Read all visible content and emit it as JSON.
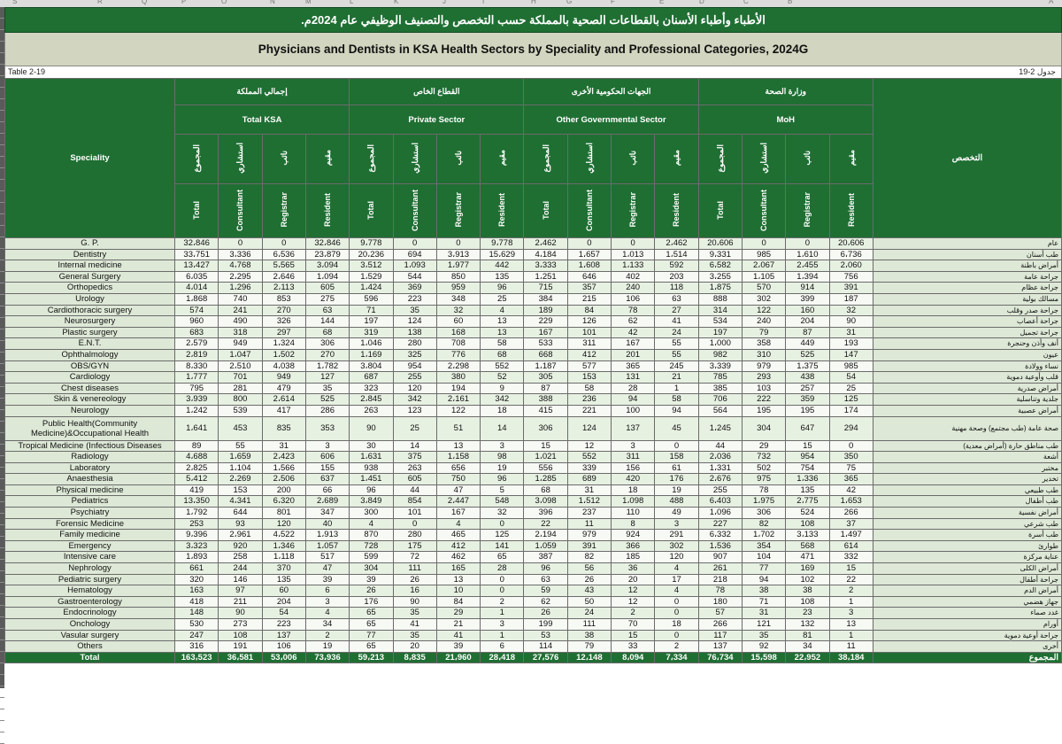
{
  "sheet_columns": [
    "S",
    "R",
    "Q",
    "P",
    "O",
    "N",
    "M",
    "L",
    "K",
    "J",
    "I",
    "H",
    "G",
    "F",
    "E",
    "D",
    "C",
    "B",
    "A"
  ],
  "title_ar": "الأطباء وأطباء الأسنان بالقطاعات الصحية بالمملكة حسب التخصص والتصنيف الوظيفي عام 2024م.",
  "title_en": "Physicians and Dentists in KSA Health Sectors by Speciality and Professional Categories, 2024G",
  "table_label_en": "Table 2-19",
  "table_label_ar": "جدول 2-19",
  "speciality_header_en": "Speciality",
  "speciality_header_ar": "التخصص",
  "groups": [
    {
      "ar": "إجمالي المملكة",
      "en": "Total KSA"
    },
    {
      "ar": "القطاع الخاص",
      "en": "Private Sector"
    },
    {
      "ar": "الجهات الحكومية الأخرى",
      "en": "Other Governmental Sector"
    },
    {
      "ar": "وزارة الصحة",
      "en": "MoH"
    }
  ],
  "subcols_ar": [
    "المجموع",
    "استشاري",
    "نائب",
    "مقيم"
  ],
  "subcols_en": [
    "Total",
    "Consultant",
    "Registrar",
    "Resident"
  ],
  "rows": [
    {
      "en": "G. P.",
      "ar": "عام",
      "v": [
        "32،846",
        "0",
        "0",
        "32،846",
        "9،778",
        "0",
        "0",
        "9،778",
        "2،462",
        "0",
        "0",
        "2،462",
        "20،606",
        "0",
        "0",
        "20،606"
      ]
    },
    {
      "en": "Dentistry",
      "ar": "طب أسنان",
      "v": [
        "33،751",
        "3،336",
        "6،536",
        "23،879",
        "20،236",
        "694",
        "3،913",
        "15،629",
        "4،184",
        "1،657",
        "1،013",
        "1،514",
        "9،331",
        "985",
        "1،610",
        "6،736"
      ]
    },
    {
      "en": "Internal medicine",
      "ar": "أمراض باطنة",
      "v": [
        "13،427",
        "4،768",
        "5،565",
        "3،094",
        "3،512",
        "1،093",
        "1،977",
        "442",
        "3،333",
        "1،608",
        "1،133",
        "592",
        "6،582",
        "2،067",
        "2،455",
        "2،060"
      ]
    },
    {
      "en": "General Surgery",
      "ar": "جراحة عامة",
      "v": [
        "6،035",
        "2،295",
        "2،646",
        "1،094",
        "1،529",
        "544",
        "850",
        "135",
        "1،251",
        "646",
        "402",
        "203",
        "3،255",
        "1،105",
        "1،394",
        "756"
      ]
    },
    {
      "en": "Orthopedics",
      "ar": "جراحة عظام",
      "v": [
        "4،014",
        "1،296",
        "2،113",
        "605",
        "1،424",
        "369",
        "959",
        "96",
        "715",
        "357",
        "240",
        "118",
        "1،875",
        "570",
        "914",
        "391"
      ]
    },
    {
      "en": "Urology",
      "ar": "مسالك بولية",
      "v": [
        "1،868",
        "740",
        "853",
        "275",
        "596",
        "223",
        "348",
        "25",
        "384",
        "215",
        "106",
        "63",
        "888",
        "302",
        "399",
        "187"
      ]
    },
    {
      "en": "Cardiothoracic surgery",
      "ar": "جراحة صدر وقلب",
      "v": [
        "574",
        "241",
        "270",
        "63",
        "71",
        "35",
        "32",
        "4",
        "189",
        "84",
        "78",
        "27",
        "314",
        "122",
        "160",
        "32"
      ]
    },
    {
      "en": "Neurosurgery",
      "ar": "جراحة أعصاب",
      "v": [
        "960",
        "490",
        "326",
        "144",
        "197",
        "124",
        "60",
        "13",
        "229",
        "126",
        "62",
        "41",
        "534",
        "240",
        "204",
        "90"
      ]
    },
    {
      "en": "Plastic surgery",
      "ar": "جراحة تجميل",
      "v": [
        "683",
        "318",
        "297",
        "68",
        "319",
        "138",
        "168",
        "13",
        "167",
        "101",
        "42",
        "24",
        "197",
        "79",
        "87",
        "31"
      ]
    },
    {
      "en": "E.N.T.",
      "ar": "أنف وأذن وحنجرة",
      "v": [
        "2،579",
        "949",
        "1،324",
        "306",
        "1،046",
        "280",
        "708",
        "58",
        "533",
        "311",
        "167",
        "55",
        "1،000",
        "358",
        "449",
        "193"
      ]
    },
    {
      "en": "Ophthalmology",
      "ar": "عيون",
      "v": [
        "2،819",
        "1،047",
        "1،502",
        "270",
        "1،169",
        "325",
        "776",
        "68",
        "668",
        "412",
        "201",
        "55",
        "982",
        "310",
        "525",
        "147"
      ]
    },
    {
      "en": "OBS/GYN",
      "ar": "نساء وولادة",
      "v": [
        "8،330",
        "2،510",
        "4،038",
        "1،782",
        "3،804",
        "954",
        "2،298",
        "552",
        "1،187",
        "577",
        "365",
        "245",
        "3،339",
        "979",
        "1،375",
        "985"
      ]
    },
    {
      "en": "Cardiology",
      "ar": "قلب وأوعية دموية",
      "v": [
        "1،777",
        "701",
        "949",
        "127",
        "687",
        "255",
        "380",
        "52",
        "305",
        "153",
        "131",
        "21",
        "785",
        "293",
        "438",
        "54"
      ]
    },
    {
      "en": "Chest diseases",
      "ar": "أمراض صدرية",
      "v": [
        "795",
        "281",
        "479",
        "35",
        "323",
        "120",
        "194",
        "9",
        "87",
        "58",
        "28",
        "1",
        "385",
        "103",
        "257",
        "25"
      ]
    },
    {
      "en": "Skin & venereology",
      "ar": "جلدية وتناسلية",
      "v": [
        "3،939",
        "800",
        "2،614",
        "525",
        "2،845",
        "342",
        "2،161",
        "342",
        "388",
        "236",
        "94",
        "58",
        "706",
        "222",
        "359",
        "125"
      ]
    },
    {
      "en": "Neurology",
      "ar": "أمراض عصبية",
      "v": [
        "1،242",
        "539",
        "417",
        "286",
        "263",
        "123",
        "122",
        "18",
        "415",
        "221",
        "100",
        "94",
        "564",
        "195",
        "195",
        "174"
      ]
    },
    {
      "en": "Public Health(Community Medicine)&Occupational Health",
      "ar": "صحة عامة (طب مجتمع) وصحة مهنية",
      "tall": true,
      "v": [
        "1،641",
        "453",
        "835",
        "353",
        "90",
        "25",
        "51",
        "14",
        "306",
        "124",
        "137",
        "45",
        "1،245",
        "304",
        "647",
        "294"
      ]
    },
    {
      "en": "Tropical Medicine (Infectious Diseases",
      "ar": "طب مناطق حارة (أمراض معدية)",
      "v": [
        "89",
        "55",
        "31",
        "3",
        "30",
        "14",
        "13",
        "3",
        "15",
        "12",
        "3",
        "0",
        "44",
        "29",
        "15",
        "0"
      ]
    },
    {
      "en": "Radiology",
      "ar": "أشعة",
      "v": [
        "4،688",
        "1،659",
        "2،423",
        "606",
        "1،631",
        "375",
        "1،158",
        "98",
        "1،021",
        "552",
        "311",
        "158",
        "2،036",
        "732",
        "954",
        "350"
      ]
    },
    {
      "en": "Laboratory",
      "ar": "مختبر",
      "v": [
        "2،825",
        "1،104",
        "1،566",
        "155",
        "938",
        "263",
        "656",
        "19",
        "556",
        "339",
        "156",
        "61",
        "1،331",
        "502",
        "754",
        "75"
      ]
    },
    {
      "en": "Anaesthesia",
      "ar": "تخدير",
      "v": [
        "5،412",
        "2،269",
        "2،506",
        "637",
        "1،451",
        "605",
        "750",
        "96",
        "1،285",
        "689",
        "420",
        "176",
        "2،676",
        "975",
        "1،336",
        "365"
      ]
    },
    {
      "en": "Physical medicine",
      "ar": "طب طبيعي",
      "v": [
        "419",
        "153",
        "200",
        "66",
        "96",
        "44",
        "47",
        "5",
        "68",
        "31",
        "18",
        "19",
        "255",
        "78",
        "135",
        "42"
      ]
    },
    {
      "en": "Pediatrics",
      "ar": "طب أطفال",
      "v": [
        "13،350",
        "4،341",
        "6،320",
        "2،689",
        "3،849",
        "854",
        "2،447",
        "548",
        "3،098",
        "1،512",
        "1،098",
        "488",
        "6،403",
        "1،975",
        "2،775",
        "1،653"
      ]
    },
    {
      "en": "Psychiatry",
      "ar": "أمراض نفسية",
      "v": [
        "1،792",
        "644",
        "801",
        "347",
        "300",
        "101",
        "167",
        "32",
        "396",
        "237",
        "110",
        "49",
        "1،096",
        "306",
        "524",
        "266"
      ]
    },
    {
      "en": "Forensic Medicine",
      "ar": "طب شرعي",
      "v": [
        "253",
        "93",
        "120",
        "40",
        "4",
        "0",
        "4",
        "0",
        "22",
        "11",
        "8",
        "3",
        "227",
        "82",
        "108",
        "37"
      ]
    },
    {
      "en": "Family medicine",
      "ar": "طب أسرة",
      "v": [
        "9،396",
        "2،961",
        "4،522",
        "1،913",
        "870",
        "280",
        "465",
        "125",
        "2،194",
        "979",
        "924",
        "291",
        "6،332",
        "1،702",
        "3،133",
        "1،497"
      ]
    },
    {
      "en": "Emergency",
      "ar": "طوارئ",
      "v": [
        "3،323",
        "920",
        "1،346",
        "1،057",
        "728",
        "175",
        "412",
        "141",
        "1،059",
        "391",
        "366",
        "302",
        "1،536",
        "354",
        "568",
        "614"
      ]
    },
    {
      "en": "Intensive care",
      "ar": "عناية مركزة",
      "v": [
        "1،893",
        "258",
        "1،118",
        "517",
        "599",
        "72",
        "462",
        "65",
        "387",
        "82",
        "185",
        "120",
        "907",
        "104",
        "471",
        "332"
      ]
    },
    {
      "en": "Nephrology",
      "ar": "أمراض الكلى",
      "v": [
        "661",
        "244",
        "370",
        "47",
        "304",
        "111",
        "165",
        "28",
        "96",
        "56",
        "36",
        "4",
        "261",
        "77",
        "169",
        "15"
      ]
    },
    {
      "en": "Pediatric surgery",
      "ar": "جراحة أطفال",
      "v": [
        "320",
        "146",
        "135",
        "39",
        "39",
        "26",
        "13",
        "0",
        "63",
        "26",
        "20",
        "17",
        "218",
        "94",
        "102",
        "22"
      ]
    },
    {
      "en": "Hematology",
      "ar": "أمراض الدم",
      "v": [
        "163",
        "97",
        "60",
        "6",
        "26",
        "16",
        "10",
        "0",
        "59",
        "43",
        "12",
        "4",
        "78",
        "38",
        "38",
        "2"
      ]
    },
    {
      "en": "Gastroenterology",
      "ar": "جهاز هضمي",
      "v": [
        "418",
        "211",
        "204",
        "3",
        "176",
        "90",
        "84",
        "2",
        "62",
        "50",
        "12",
        "0",
        "180",
        "71",
        "108",
        "1"
      ]
    },
    {
      "en": "Endocrinology",
      "ar": "غدد صماء",
      "v": [
        "148",
        "90",
        "54",
        "4",
        "65",
        "35",
        "29",
        "1",
        "26",
        "24",
        "2",
        "0",
        "57",
        "31",
        "23",
        "3"
      ]
    },
    {
      "en": "Onchology",
      "ar": "أورام",
      "v": [
        "530",
        "273",
        "223",
        "34",
        "65",
        "41",
        "21",
        "3",
        "199",
        "111",
        "70",
        "18",
        "266",
        "121",
        "132",
        "13"
      ]
    },
    {
      "en": "Vasular surgery",
      "ar": "جراحة أوعية دموية",
      "v": [
        "247",
        "108",
        "137",
        "2",
        "77",
        "35",
        "41",
        "1",
        "53",
        "38",
        "15",
        "0",
        "117",
        "35",
        "81",
        "1"
      ]
    },
    {
      "en": "Others",
      "ar": "أخرى",
      "v": [
        "316",
        "191",
        "106",
        "19",
        "65",
        "20",
        "39",
        "6",
        "114",
        "79",
        "33",
        "2",
        "137",
        "92",
        "34",
        "11"
      ]
    }
  ],
  "total": {
    "en": "Total",
    "ar": "المجموع",
    "v": [
      "163،523",
      "36،581",
      "53،006",
      "73،936",
      "59،213",
      "8،835",
      "21،960",
      "28،418",
      "27،576",
      "12،148",
      "8،094",
      "7،334",
      "76،734",
      "15،598",
      "22،952",
      "38،184"
    ]
  }
}
